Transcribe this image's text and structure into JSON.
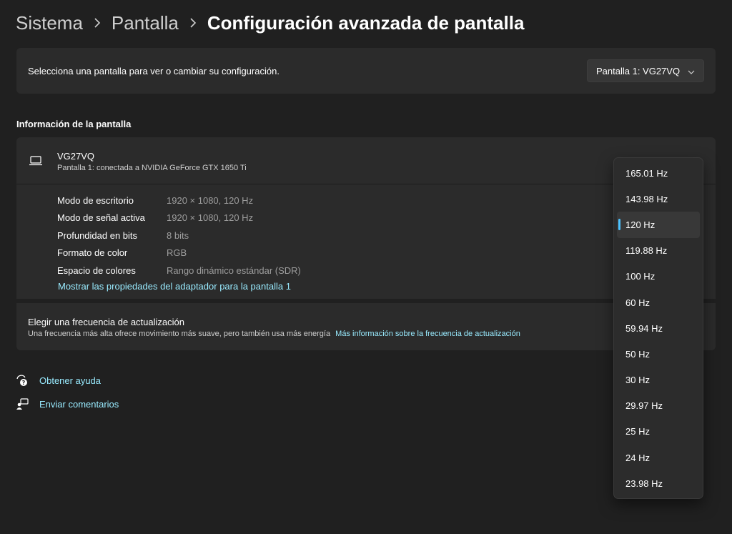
{
  "breadcrumb": {
    "items": [
      "Sistema",
      "Pantalla"
    ],
    "current": "Configuración avanzada de pantalla"
  },
  "select_display": {
    "label": "Selecciona una pantalla para ver o cambiar su configuración.",
    "selected": "Pantalla 1: VG27VQ"
  },
  "info_section": {
    "title": "Información de la pantalla",
    "monitor_name": "VG27VQ",
    "monitor_subtitle": "Pantalla 1: conectada a NVIDIA GeForce GTX 1650 Ti",
    "properties": [
      {
        "key": "Modo de escritorio",
        "value": "1920 × 1080, 120 Hz"
      },
      {
        "key": "Modo de señal activa",
        "value": "1920 × 1080, 120 Hz"
      },
      {
        "key": "Profundidad en bits",
        "value": "8 bits"
      },
      {
        "key": "Formato de color",
        "value": "RGB"
      },
      {
        "key": "Espacio de colores",
        "value": "Rango dinámico estándar (SDR)"
      }
    ],
    "adapter_link": "Mostrar las propiedades del adaptador para la pantalla 1"
  },
  "refresh": {
    "title": "Elegir una frecuencia de actualización",
    "description": "Una frecuencia más alta ofrece movimiento más suave, pero también usa más energía",
    "link": "Más información sobre la frecuencia de actualización"
  },
  "footer_links": {
    "help": "Obtener ayuda",
    "feedback": "Enviar comentarios"
  },
  "frequency_options": [
    "165.01 Hz",
    "143.98 Hz",
    "120 Hz",
    "119.88 Hz",
    "100 Hz",
    "60 Hz",
    "59.94 Hz",
    "50 Hz",
    "30 Hz",
    "29.97 Hz",
    "25 Hz",
    "24 Hz",
    "23.98 Hz"
  ],
  "selected_frequency": "120 Hz",
  "colors": {
    "background": "#202020",
    "card": "#2b2b2b",
    "link": "#99ebff",
    "accent": "#4cc2ff"
  }
}
